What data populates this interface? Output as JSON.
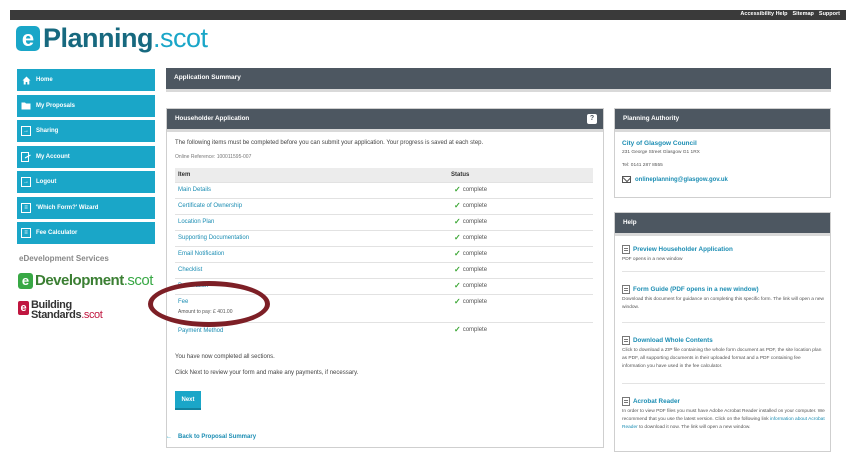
{
  "topbar": {
    "links": [
      "Accessibility Help",
      "Sitemap",
      "Support"
    ]
  },
  "logo": {
    "letter": "e",
    "brand": "Planning",
    "suffix": ".scot"
  },
  "nav": {
    "items": [
      {
        "label": "Home",
        "icon": "home-icon"
      },
      {
        "label": "My Proposals",
        "icon": "folder-icon"
      },
      {
        "label": "Sharing",
        "icon": "share-icon"
      },
      {
        "label": "My Account",
        "icon": "account-icon"
      },
      {
        "label": "Logout",
        "icon": "logout-icon"
      },
      {
        "label": "'Which Form?' Wizard",
        "icon": "wizard-icon"
      },
      {
        "label": "Fee Calculator",
        "icon": "calculator-icon"
      }
    ]
  },
  "services": {
    "title": "eDevelopment Services",
    "edev": {
      "letter": "e",
      "brand": "Development",
      "suffix": ".scot"
    },
    "bs": {
      "letter": "e",
      "line1": "Building",
      "line2": "Standards",
      "suffix": ".scot"
    }
  },
  "summary": {
    "title": "Application Summary"
  },
  "application": {
    "title": "Householder Application",
    "help_badge": "?",
    "intro": "The following items must be completed before you can submit your application. Your progress is saved at each step.",
    "reference": "Online Reference: 100011595-007",
    "columns": {
      "item": "Item",
      "status": "Status"
    },
    "rows": [
      {
        "item": "Main Details",
        "status": "complete"
      },
      {
        "item": "Certificate of Ownership",
        "status": "complete"
      },
      {
        "item": "Location Plan",
        "status": "complete"
      },
      {
        "item": "Supporting Documentation",
        "status": "complete"
      },
      {
        "item": "Email Notification",
        "status": "complete"
      },
      {
        "item": "Checklist",
        "status": "complete"
      },
      {
        "item": "Declaration",
        "status": "complete"
      },
      {
        "item": "Fee",
        "status": "complete",
        "note": "Amount to pay: £ 401.00"
      },
      {
        "item": "Payment Method",
        "status": "complete"
      }
    ],
    "done_text": "You have now completed all sections.",
    "next_text": "Click Next to review your form and make any payments, if necessary.",
    "next_button": "Next",
    "back_link": "Back to Proposal Summary"
  },
  "authority": {
    "title": "Planning Authority",
    "name": "City of Glasgow Council",
    "address": "231 George Street Glasgow G1 1RX",
    "tel": "Tel: 0141 287 8555",
    "email": "onlineplanning@glasgow.gov.uk"
  },
  "help": {
    "title": "Help",
    "items": [
      {
        "title": "Preview Householder Application",
        "desc": "PDF opens in a new window"
      },
      {
        "title": "Form Guide (PDF opens in a new window)",
        "desc": "Download this document for guidance on completing this specific form. The link will open a new window."
      },
      {
        "title": "Download Whole Contents",
        "desc": "Click to download a ZIP file containing the whole form document as PDF, the site location plan as PDF, all supporting documents in their uploaded format and a PDF containing fee information you have used in the fee calculator."
      },
      {
        "title": "Acrobat Reader",
        "desc_pre": "In order to view PDF files you must have Adobe Acrobat Reader installed on your computer. We recommend that you use the latest version. Click on the following link ",
        "desc_link": "information about Acrobat Reader",
        "desc_post": " to download it now. The link will open a new window."
      }
    ]
  },
  "colors": {
    "accent": "#1aa6c8",
    "header": "#4d5761",
    "link": "#1b8db3",
    "complete": "#3ba634",
    "annotation": "#7d1f26"
  }
}
